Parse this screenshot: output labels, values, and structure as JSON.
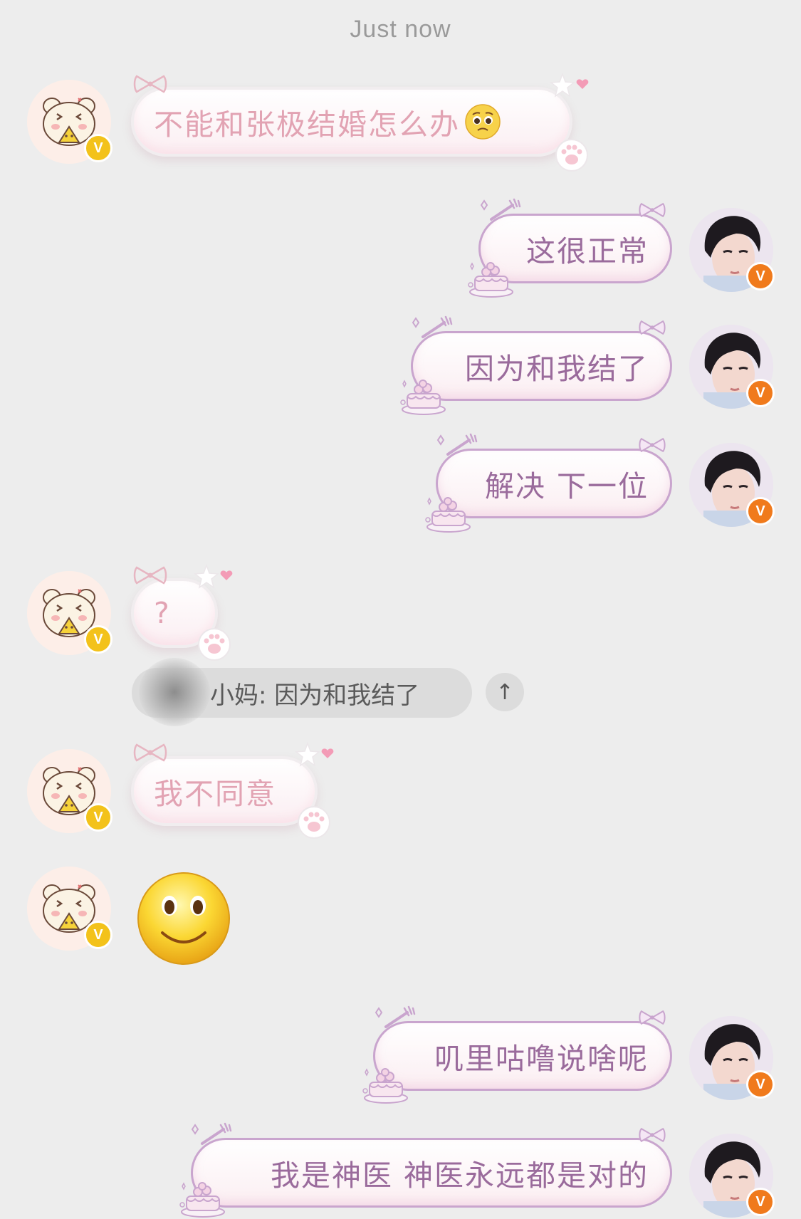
{
  "timestamp": "Just now",
  "reply_quote": {
    "text": "小妈: 因为和我结了",
    "icon": "scroll-to-top-icon",
    "arrow_glyph": "↑"
  },
  "messages": [
    {
      "side": "left",
      "type": "text",
      "text": "不能和张极结婚怎么办",
      "emoji": "pleading-face-icon"
    },
    {
      "side": "right",
      "type": "text",
      "text": "这很正常"
    },
    {
      "side": "right",
      "type": "text",
      "text": "因为和我结了"
    },
    {
      "side": "right",
      "type": "text",
      "text": "解决 下一位"
    },
    {
      "side": "left",
      "type": "text",
      "text": "?"
    },
    {
      "side": "left",
      "type": "text",
      "text": "我不同意"
    },
    {
      "side": "left",
      "type": "sticker",
      "emoji": "smiley-face-icon"
    },
    {
      "side": "right",
      "type": "text",
      "text": "叽里咕噜说啥呢"
    },
    {
      "side": "right",
      "type": "text",
      "text": "我是神医 神医永远都是对的"
    }
  ],
  "badges": {
    "left": "V",
    "right": "V"
  },
  "colors": {
    "background": "#ededed",
    "left_text": "#e2a3b3",
    "right_text": "#9a6b9c",
    "right_border": "#c9a5ce",
    "badge_gold": "#f3c21a",
    "badge_orange": "#f07a1c"
  }
}
